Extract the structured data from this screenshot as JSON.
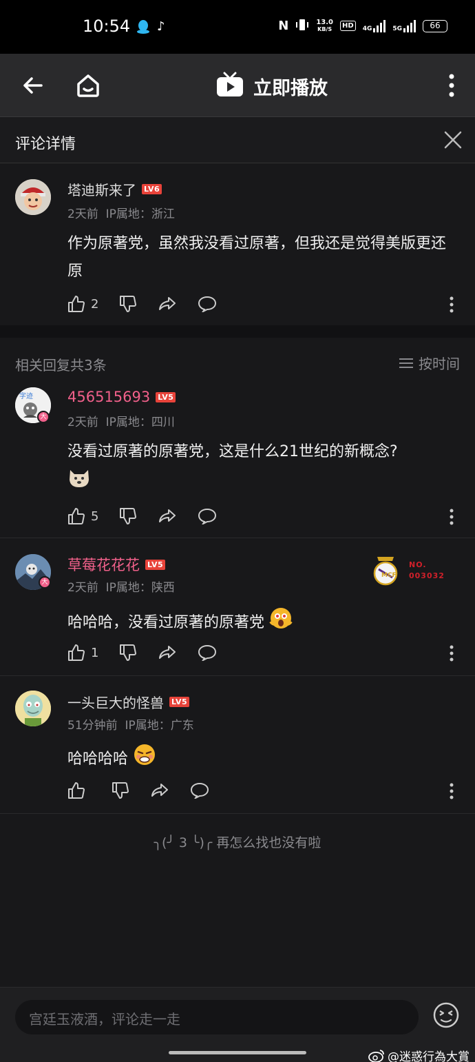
{
  "status_bar": {
    "time": "10:54",
    "net_speed_value": "13.0",
    "net_speed_unit": "KB/S",
    "hd_badge": "HD",
    "signal1_label": "4G",
    "signal2_label": "5G",
    "battery": "66"
  },
  "app_bar": {
    "play_label": "立即播放"
  },
  "panel": {
    "title": "评论详情"
  },
  "main_comment": {
    "username": "塔迪斯来了",
    "level": "LV6",
    "level_color": "#e8433a",
    "time": "2天前",
    "ip": "IP属地：浙江",
    "text": "作为原著党，虽然我没看过原著，但我还是觉得美版更还原",
    "likes": "2"
  },
  "replies_header": {
    "count_text": "相关回复共3条",
    "sort_label": "按时间"
  },
  "replies": [
    {
      "username": "456515693",
      "level": "LV5",
      "time": "2天前",
      "ip": "IP属地：四川",
      "text": "没看过原著的原著党，这是什么21世纪的新概念?",
      "likes": "5",
      "emoji": "dog-emoji"
    },
    {
      "username": "草莓花花花",
      "level": "LV5",
      "time": "2天前",
      "ip": "IP属地：陕西",
      "text": "哈哈哈，没看过原著的原著党",
      "likes": "1",
      "badge_no_label": "NO.",
      "badge_no_value": "003032",
      "emoji": "shocked-emoji"
    },
    {
      "username": "一头巨大的怪兽",
      "level": "LV5",
      "time": "51分钟前",
      "ip": "IP属地：广东",
      "text": "哈哈哈哈",
      "likes": "",
      "emoji": "embarrassed-emoji"
    }
  ],
  "end_note": "╮(╯ 3 ╰)╭ 再怎么找也没有啦",
  "input": {
    "placeholder": "宫廷玉液酒，评论走一走"
  },
  "watermark": "@迷惑行為大賞",
  "colors": {
    "pink_name": "#f0608a",
    "level_badge": "#e8433a",
    "background": "#18181a"
  }
}
